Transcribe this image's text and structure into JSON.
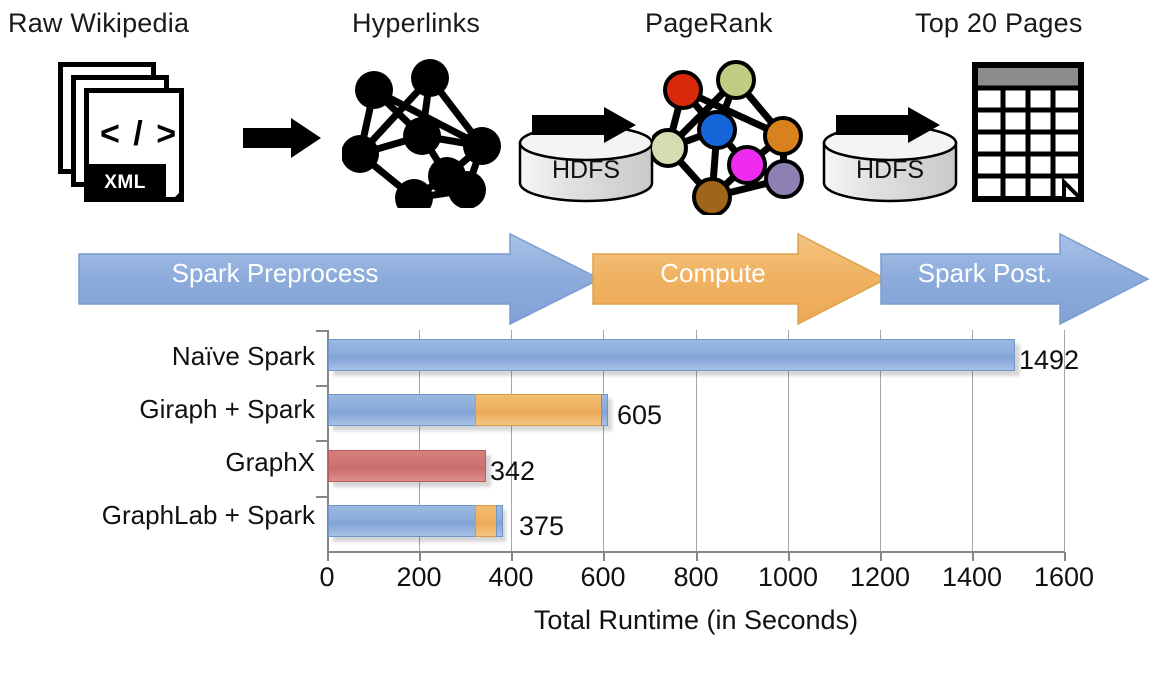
{
  "pipeline": {
    "stages": [
      {
        "caption": "Raw Wikipedia",
        "icon": "xml-documents-icon",
        "doc_badge": "XML",
        "doc_glyph": "< / >"
      },
      {
        "caption": "Hyperlinks",
        "icon": "link-graph-icon"
      },
      {
        "caption": "PageRank",
        "icon": "pagerank-graph-icon"
      },
      {
        "caption": "Top 20 Pages",
        "icon": "results-table-icon"
      }
    ],
    "stores": [
      {
        "label": "HDFS",
        "icon": "hdfs-cylinder-icon"
      },
      {
        "label": "HDFS",
        "icon": "hdfs-cylinder-icon"
      }
    ],
    "flow_arrows": [
      {
        "label": "Spark Preprocess",
        "color": "#8cabdb"
      },
      {
        "label": "Compute",
        "color": "#efb261"
      },
      {
        "label": "Spark Post.",
        "color": "#8cabdb"
      }
    ]
  },
  "colors": {
    "spark_blue": "#8cabdb",
    "compute_orange": "#efb261",
    "graphx_red": "#cf7272",
    "grid": "#a6a6a6",
    "axis": "#868686",
    "table_header": "#8c8c8c"
  },
  "graph_nodes": [
    {
      "name": "node-red",
      "color": "#d9290b"
    },
    {
      "name": "node-olive",
      "color": "#bfcc82"
    },
    {
      "name": "node-blue",
      "color": "#1565d8"
    },
    {
      "name": "node-orange",
      "color": "#d9801f"
    },
    {
      "name": "node-paleolive",
      "color": "#d4dcb0"
    },
    {
      "name": "node-magenta",
      "color": "#ef2bef"
    },
    {
      "name": "node-purple",
      "color": "#8d81b3"
    },
    {
      "name": "node-brown",
      "color": "#a06518"
    }
  ],
  "chart_data": {
    "type": "bar",
    "orientation": "horizontal",
    "stacked": true,
    "title": "",
    "xlabel": "Total Runtime (in Seconds)",
    "ylabel": "",
    "xlim": [
      0,
      1600
    ],
    "xticks": [
      "0",
      "200",
      "400",
      "600",
      "800",
      "1000",
      "1200",
      "1400",
      "1600"
    ],
    "grid": true,
    "legend": "none",
    "categories": [
      "Naïve Spark",
      "Giraph + Spark",
      "GraphX",
      "GraphLab + Spark"
    ],
    "series": [
      {
        "name": "Spark Preprocess",
        "color": "#8cabdb",
        "values": [
          1492,
          320,
          0,
          320
        ]
      },
      {
        "name": "Compute",
        "color": "#efb261",
        "values": [
          0,
          275,
          0,
          45
        ]
      },
      {
        "name": "Spark Post.",
        "color": "#8cabdb",
        "values": [
          0,
          10,
          0,
          10
        ]
      },
      {
        "name": "GraphX",
        "color": "#cf7272",
        "values": [
          0,
          0,
          342,
          0
        ]
      }
    ],
    "totals": [
      1492,
      605,
      342,
      375
    ],
    "data_labels": [
      "1492",
      "605",
      "342",
      "375"
    ]
  }
}
